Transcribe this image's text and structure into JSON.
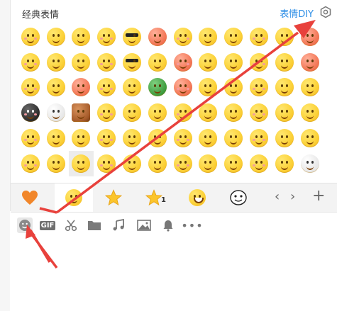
{
  "panel": {
    "title": "经典表情",
    "diy_label": "表情DIY"
  },
  "categories": [
    {
      "name": "heart",
      "active": false
    },
    {
      "name": "classic-face",
      "active": true
    },
    {
      "name": "star",
      "active": false
    },
    {
      "name": "star-1",
      "active": false,
      "badge": "1"
    },
    {
      "name": "grin-face",
      "active": false
    },
    {
      "name": "ghost-face",
      "active": false
    }
  ],
  "nav": {
    "prev": "‹",
    "next": "›",
    "add": "+"
  },
  "toolbar": [
    {
      "name": "emoji-toolbar-button",
      "icon": "emoji-icon",
      "active": true
    },
    {
      "name": "gif-button",
      "icon": "gif-icon",
      "label": "GIF"
    },
    {
      "name": "screenshot-button",
      "icon": "scissors-icon"
    },
    {
      "name": "file-button",
      "icon": "folder-icon"
    },
    {
      "name": "music-button",
      "icon": "music-icon"
    },
    {
      "name": "image-button",
      "icon": "image-icon"
    },
    {
      "name": "notify-button",
      "icon": "bell-icon"
    },
    {
      "name": "more-button",
      "icon": "more-icon",
      "label": "•••"
    }
  ],
  "colors": {
    "accent": "#2b8de6",
    "arrow": "#e8413c",
    "face": "#fcd33b",
    "category_bar": "#f3f3f3"
  },
  "selected_emoji": {
    "row": 6,
    "col": 3
  }
}
